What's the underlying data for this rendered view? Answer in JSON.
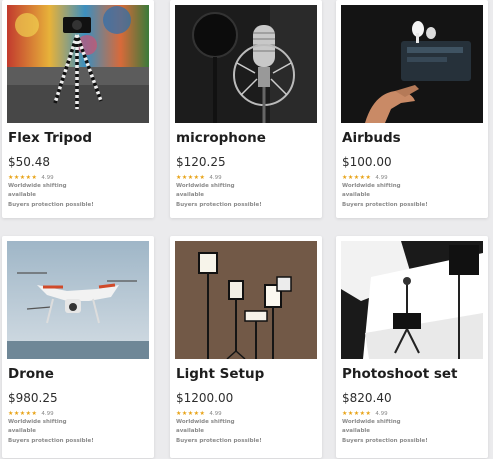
{
  "products": [
    {
      "title": "Flex Tripod",
      "price": "$50.48",
      "stars": "★★★★★",
      "rating": "4.99",
      "shipping": "Worldwide shifting",
      "availability": "available",
      "protection": "Buyers protection possible!",
      "image_icon": "tripod-photo"
    },
    {
      "title": "microphone",
      "price": "$120.25",
      "stars": "★★★★★",
      "rating": "4.99",
      "shipping": "Worldwide shifting",
      "availability": "available",
      "protection": "Buyers protection possible!",
      "image_icon": "microphone-photo"
    },
    {
      "title": "Airbuds",
      "price": "$100.00",
      "stars": "★★★★★",
      "rating": "4.99",
      "shipping": "Worldwide shifting",
      "availability": "available",
      "protection": "Buyers protection possible!",
      "image_icon": "airbuds-photo"
    },
    {
      "title": "Drone",
      "price": "$980.25",
      "stars": "★★★★★",
      "rating": "4.99",
      "shipping": "Worldwide shifting",
      "availability": "available",
      "protection": "Buyers protection possible!",
      "image_icon": "drone-photo"
    },
    {
      "title": "Light Setup",
      "price": "$1200.00",
      "stars": "★★★★★",
      "rating": "4.99",
      "shipping": "Worldwide shifting",
      "availability": "available",
      "protection": "Buyers protection possible!",
      "image_icon": "light-setup-photo"
    },
    {
      "title": "Photoshoot set",
      "price": "$820.40",
      "stars": "★★★★★",
      "rating": "4.99",
      "shipping": "Worldwide shifting",
      "availability": "available",
      "protection": "Buyers protection possible!",
      "image_icon": "photoshoot-set-photo"
    }
  ],
  "colors": {
    "background": "#ebebed",
    "card": "#ffffff",
    "star": "#e8a317",
    "title": "#1e1e1e"
  }
}
